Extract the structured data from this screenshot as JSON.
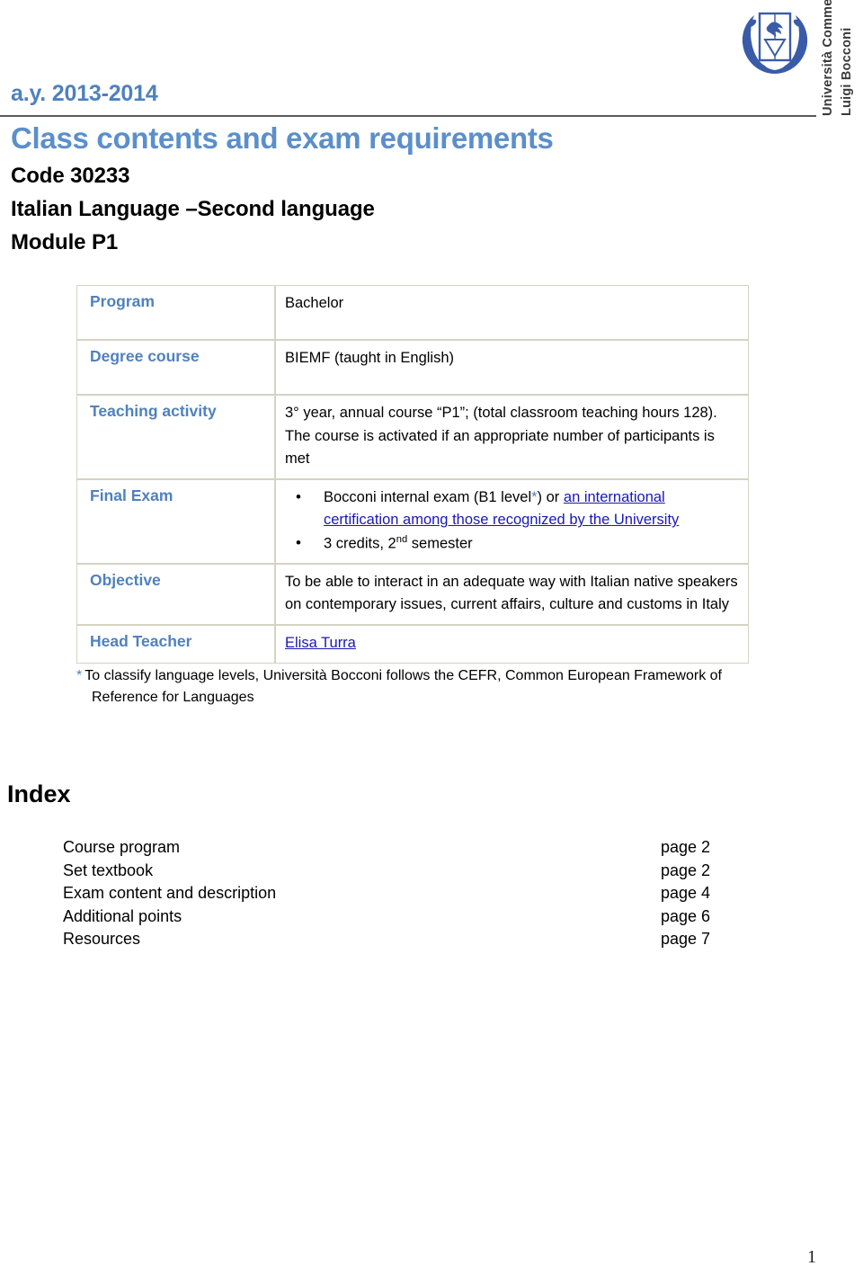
{
  "logo": {
    "crest_name": "bocconi-crest",
    "wordmark_line1": "Università Commerciale",
    "wordmark_line2": "Luigi Bocconi",
    "crest_color": "#3A5BA8"
  },
  "header": {
    "academic_year": "a.y. 2013-2014",
    "title": "Class contents and exam requirements",
    "code": "Code 30233",
    "course": "Italian Language –Second language",
    "module": "Module P1",
    "title_color": "#5B8FCB",
    "rule_color": "#595959"
  },
  "info_table": {
    "rows": [
      {
        "label": "Program",
        "value": "Bachelor"
      },
      {
        "label": "Degree course",
        "value": "BIEMF (taught in English)"
      },
      {
        "label": "Teaching activity",
        "value_line1": "3° year, annual course “P1”; (total classroom teaching hours 128).",
        "value_line2": "The course is activated if an appropriate number of participants is met"
      },
      {
        "label": "Final Exam",
        "bullet1_pre": "Bocconi internal exam  (B1 level",
        "bullet1_star": "*",
        "bullet1_mid": ") or ",
        "bullet1_link": "an international certification among those recognized by the University",
        "bullet2_pre": "3 credits, 2",
        "bullet2_sup": "nd",
        "bullet2_post": " semester"
      },
      {
        "label": "Objective",
        "value": "To be able to interact in an adequate way with Italian native speakers on contemporary issues, current affairs, culture and customs in Italy"
      },
      {
        "label": "Head Teacher",
        "value": "Elisa Turra"
      }
    ],
    "label_color": "#4F81BD",
    "border_color": "#D6D2C4",
    "link_color": "#1818B8"
  },
  "footnote": {
    "star": "*",
    "line1": "To classify language levels, Università Bocconi follows the CEFR, Common  European Framework of",
    "line2": "Reference for Languages"
  },
  "index": {
    "heading": "Index",
    "items": [
      {
        "label": "Course program",
        "page": "page 2"
      },
      {
        "label": "Set textbook",
        "page": "page 2"
      },
      {
        "label": "Exam content and description",
        "page": "page 4"
      },
      {
        "label": "Additional points",
        "page": "page 6"
      },
      {
        "label": "Resources",
        "page": "page 7"
      }
    ]
  },
  "footer": {
    "page_number": "1"
  }
}
